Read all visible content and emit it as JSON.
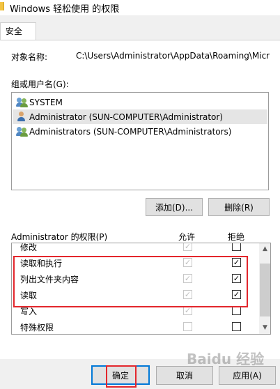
{
  "window": {
    "title": "Windows 轻松使用 的权限"
  },
  "tabs": [
    {
      "label": "安全"
    }
  ],
  "object": {
    "label": "对象名称:",
    "path": "C:\\Users\\Administrator\\AppData\\Roaming\\Micr"
  },
  "groups": {
    "label": "组或用户名(G):",
    "items": [
      {
        "name": "SYSTEM",
        "icon": "user-group-icon",
        "selected": false
      },
      {
        "name": "Administrator (SUN-COMPUTER\\Administrator)",
        "icon": "user-icon",
        "selected": true
      },
      {
        "name": "Administrators (SUN-COMPUTER\\Administrators)",
        "icon": "user-group-icon",
        "selected": false
      }
    ]
  },
  "buttons": {
    "add": "添加(D)...",
    "remove": "删除(R)",
    "ok": "确定",
    "cancel": "取消",
    "apply": "应用(A)"
  },
  "permissions": {
    "title": "Administrator 的权限(P)",
    "allow_header": "允许",
    "deny_header": "拒绝",
    "rows": [
      {
        "name": "修改",
        "allow": true,
        "allow_disabled": true,
        "deny": false
      },
      {
        "name": "读取和执行",
        "allow": true,
        "allow_disabled": true,
        "deny": true
      },
      {
        "name": "列出文件夹内容",
        "allow": true,
        "allow_disabled": true,
        "deny": true
      },
      {
        "name": "读取",
        "allow": true,
        "allow_disabled": true,
        "deny": true
      },
      {
        "name": "写入",
        "allow": true,
        "allow_disabled": true,
        "deny": false
      },
      {
        "name": "特殊权限",
        "allow": false,
        "allow_disabled": true,
        "deny": false
      }
    ]
  },
  "colors": {
    "highlight": "#e3262c",
    "focus": "#0078d7",
    "selected_row": "#e5e5e5"
  },
  "watermark": "Baidu 经验"
}
